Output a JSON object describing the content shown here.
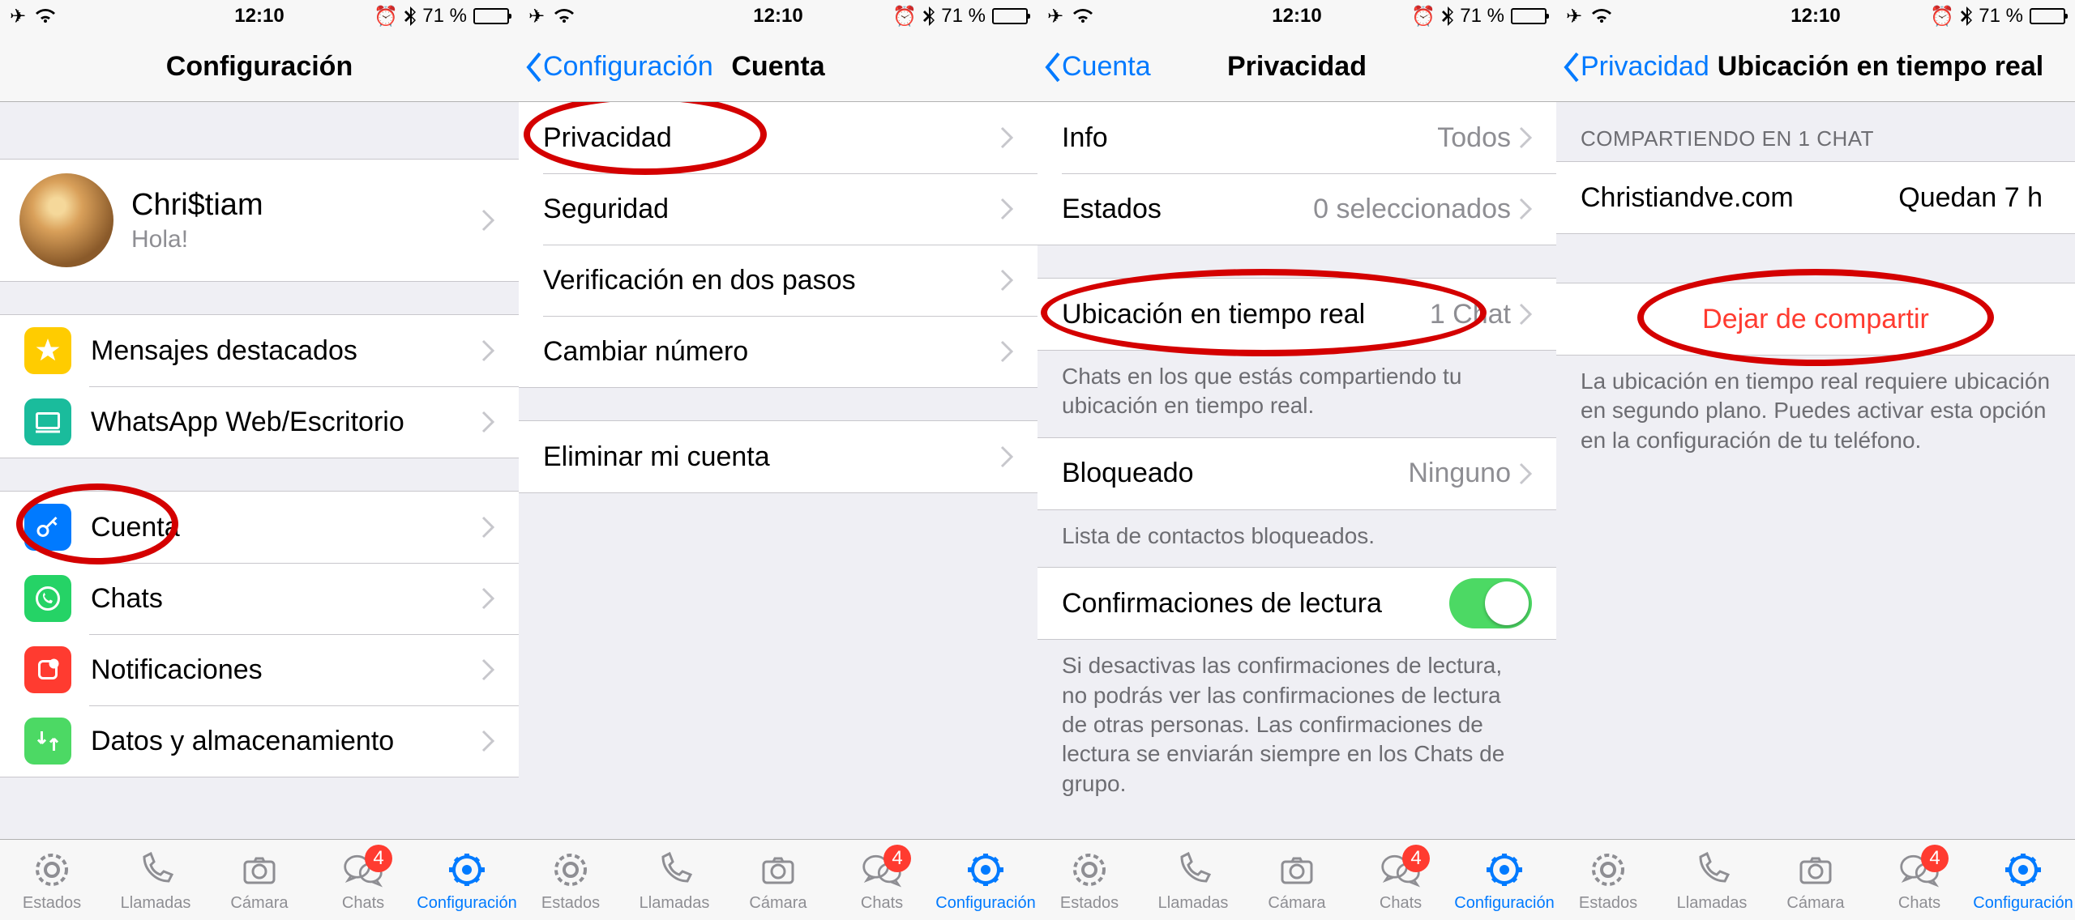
{
  "status": {
    "time": "12:10",
    "battery": "71 %"
  },
  "tabbar": {
    "items": [
      {
        "label": "Estados"
      },
      {
        "label": "Llamadas"
      },
      {
        "label": "Cámara"
      },
      {
        "label": "Chats",
        "badge": "4"
      },
      {
        "label": "Configuración"
      }
    ]
  },
  "s1": {
    "title": "Configuración",
    "profile": {
      "name": "Chri$tiam",
      "status": "Hola!"
    },
    "rows": {
      "starred": "Mensajes destacados",
      "web": "WhatsApp Web/Escritorio",
      "account": "Cuenta",
      "chats": "Chats",
      "notifications": "Notificaciones",
      "data": "Datos y almacenamiento"
    }
  },
  "s2": {
    "back": "Configuración",
    "title": "Cuenta",
    "rows": {
      "privacy": "Privacidad",
      "security": "Seguridad",
      "twostep": "Verificación en dos pasos",
      "change": "Cambiar número",
      "delete": "Eliminar mi cuenta"
    }
  },
  "s3": {
    "back": "Cuenta",
    "title": "Privacidad",
    "rows": {
      "info": {
        "label": "Info",
        "value": "Todos"
      },
      "states": {
        "label": "Estados",
        "value": "0 seleccionados"
      },
      "live": {
        "label": "Ubicación en tiempo real",
        "value": "1 Chat"
      },
      "live_footer": "Chats en los que estás compartiendo tu ubicación en tiempo real.",
      "blocked": {
        "label": "Bloqueado",
        "value": "Ninguno"
      },
      "blocked_footer": "Lista de contactos bloqueados.",
      "readreceipts": "Confirmaciones de lectura",
      "readreceipts_footer": "Si desactivas las confirmaciones de lectura, no podrás ver las confirmaciones de lectura de otras personas. Las confirmaciones de lectura se enviarán siempre en los Chats de grupo."
    }
  },
  "s4": {
    "back": "Privacidad",
    "title": "Ubicación en tiempo real",
    "header": "COMPARTIENDO EN 1 CHAT",
    "share": {
      "name": "Christiandve.com",
      "remaining": "Quedan 7 h"
    },
    "stop": "Dejar de compartir",
    "footer": "La ubicación en tiempo real requiere ubicación en segundo plano. Puedes activar esta opción en la configuración de tu teléfono."
  }
}
